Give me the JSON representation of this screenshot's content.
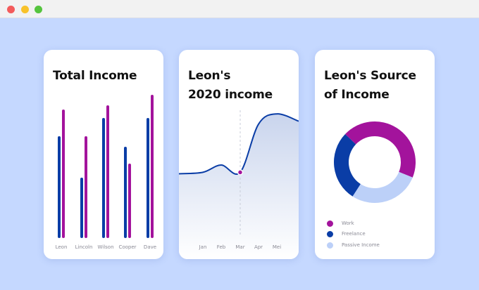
{
  "window": {
    "controls": [
      "close",
      "minimize",
      "maximize"
    ],
    "colors": {
      "close": "#f35b5b",
      "minimize": "#f8c22a",
      "maximize": "#55c43e"
    }
  },
  "cards": {
    "total_income": {
      "title": "Total Income"
    },
    "yearly_income": {
      "title_line1": "Leon's",
      "title_line2": "2020 income"
    },
    "income_source": {
      "title_line1": "Leon's Source",
      "title_line2": "of Income"
    }
  },
  "colors": {
    "background": "#c5d8ff",
    "blue": "#0a3da6",
    "purple": "#a3139c",
    "light_blue": "#bcd0f8",
    "title": "#111111",
    "label": "#8a8a95"
  },
  "chart_data": [
    {
      "type": "bar",
      "categories": [
        "Leon",
        "Lincoln",
        "Wilson",
        "Cooper",
        "Dave"
      ],
      "series": [
        {
          "values": [
            148,
            88,
            174,
            132,
            174
          ]
        },
        {
          "values": [
            186,
            148,
            193,
            108,
            208
          ]
        }
      ],
      "ylim": [
        0,
        220
      ],
      "grid": false
    },
    {
      "type": "area",
      "x": [
        "Jan",
        "Feb",
        "Mar",
        "Apr",
        "Mei"
      ],
      "series": [
        {
          "values": [
            45,
            50,
            45,
            78,
            85
          ]
        }
      ],
      "highlight": {
        "x": "Mar",
        "value": 45
      },
      "ylim": [
        0,
        100
      ],
      "grid": false
    },
    {
      "type": "pie",
      "donut": true,
      "categories": [
        "Work",
        "Freelance",
        "Passive Income"
      ],
      "series": [
        {
          "values": [
            44,
            28,
            28
          ]
        }
      ],
      "colors": [
        "#a3139c",
        "#0a3da6",
        "#bcd0f8"
      ],
      "legend": "bottom"
    }
  ]
}
